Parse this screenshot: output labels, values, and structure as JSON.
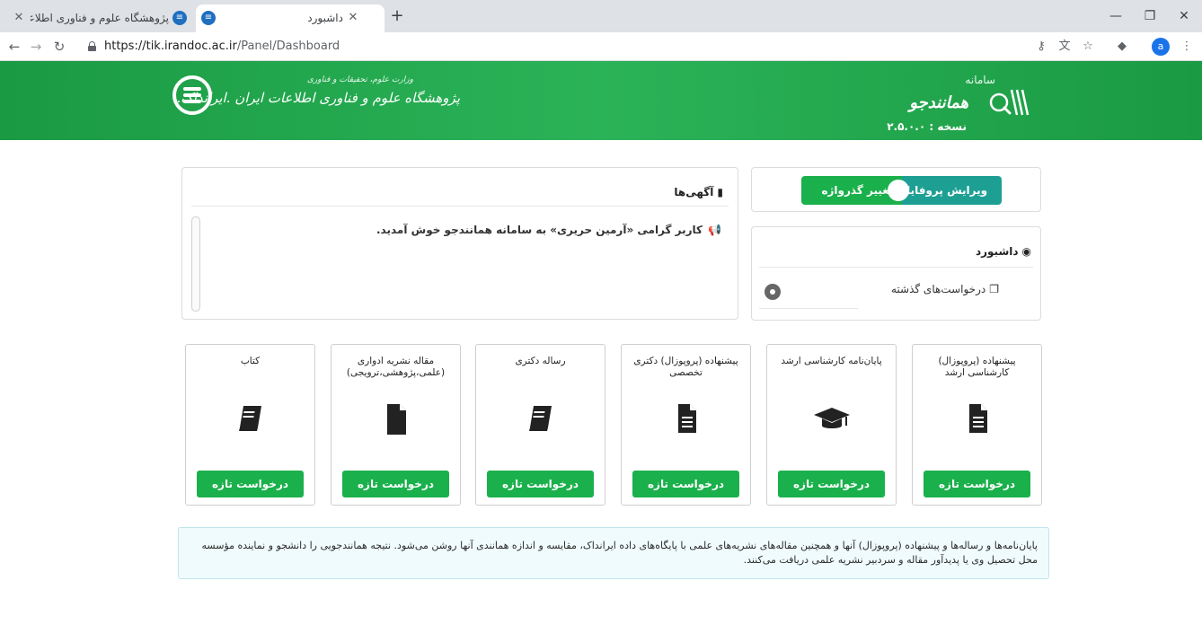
{
  "browser": {
    "tabs": [
      {
        "title": "پژوهشگاه علوم و فناوری اطلاعات ایران"
      },
      {
        "title": "داشبورد"
      }
    ],
    "url_host": "https://tik.irandoc.ac.ir",
    "url_path": "/Panel/Dashboard",
    "profile_initial": "a"
  },
  "header": {
    "org_ministry": "وزارت علوم، تحقیقات و فناوری",
    "org_name": "پژوهشگاه علوم و فناوری اطلاعات ایران   .ایرانداک.",
    "brand_small": "سامانه",
    "brand_name": "همانندجو",
    "version": "نسخه : ۲.۵.۰.۰"
  },
  "profile": {
    "edit_label": "ویرایش پروفایل",
    "password_label": "تغییر گذرواژه"
  },
  "dashboard": {
    "title": "داشبورد",
    "past_requests": "درخواست‌های گذشته"
  },
  "announcements": {
    "title": "آگهی‌ها",
    "message": "کاربر گرامی «آرمین حریری» به سامانه همانندجو خوش آمدید."
  },
  "cards": [
    {
      "title": "پیشنهاده (پروپوزال) کارشناسی ارشد",
      "icon": "document-icon",
      "button": "درخواست تازه"
    },
    {
      "title": "پایان‌نامه کارشناسی ارشد",
      "icon": "graduation-cap-icon",
      "button": "درخواست تازه"
    },
    {
      "title": "پیشنهاده (پروپوزال) دکتری تخصصی",
      "icon": "document-icon",
      "button": "درخواست تازه"
    },
    {
      "title": "رساله دکتری",
      "icon": "book-icon",
      "button": "درخواست تازه"
    },
    {
      "title": "مقاله نشریه ادواری (علمی،پژوهشی،ترویجی)",
      "icon": "file-icon",
      "button": "درخواست تازه"
    },
    {
      "title": "کتاب",
      "icon": "book-icon",
      "button": "درخواست تازه"
    }
  ],
  "note": {
    "text": "پایان‌نامه‌ها و رساله‌ها و پیشنهاده (پروپوزال) آنها و همچنین مقاله‌های نشریه‌های علمی با پایگاه‌های داده ایرانداک، مقایسه و اندازه همانندی آنها روشن می‌شود. نتیجه همانندجویی را دانشجو و نماینده مؤسسه محل تحصیل وی یا پدیدآور مقاله و سردبیر نشریه علمی دریافت می‌کنند."
  },
  "colors": {
    "header_green": "#2bb358",
    "button_green": "#1ab04b",
    "teal": "#1e9f93",
    "note_bg": "#f0fbfd"
  }
}
